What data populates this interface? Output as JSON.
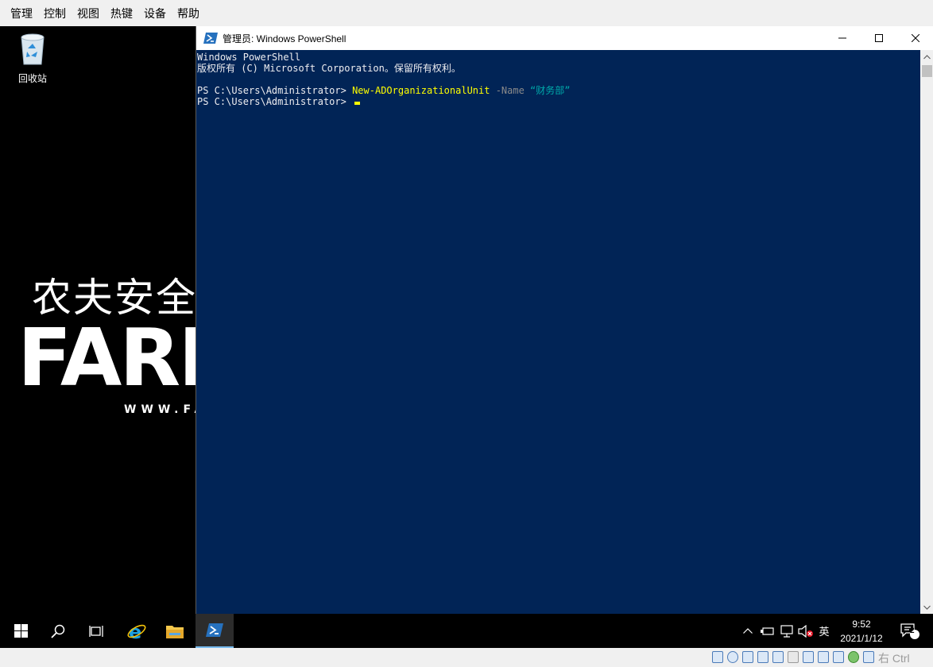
{
  "host_menu": {
    "items": [
      "管理",
      "控制",
      "视图",
      "热键",
      "设备",
      "帮助"
    ]
  },
  "desktop": {
    "recycle_bin_label": "回收站",
    "wallpaper": {
      "cn_text": "农夫安全",
      "logo_text": "FARM",
      "url_text": "WWW.FA"
    }
  },
  "powershell": {
    "title": "管理员: Windows PowerShell",
    "lines": {
      "line1": "Windows PowerShell",
      "line2": "版权所有 (C) Microsoft Corporation。保留所有权利。",
      "prompt1": "PS C:\\Users\\Administrator> ",
      "cmd": "New-ADOrganizationalUnit",
      "param": " -Name ",
      "arg": "“财务部”",
      "prompt2": "PS C:\\Users\\Administrator> "
    },
    "colors": {
      "background": "#012456",
      "command": "#ffff00",
      "parameter": "#8a8a8a",
      "string": "#00aaaa"
    }
  },
  "taskbar": {
    "icons": [
      "windows-start-icon",
      "search-icon",
      "task-view-icon",
      "internet-explorer-icon",
      "file-explorer-icon",
      "powershell-icon"
    ],
    "tray": {
      "ime": "英",
      "time": "9:52",
      "date": "2021/1/12",
      "notification_count": "2"
    }
  },
  "host_status": {
    "host_key": "右 Ctrl"
  }
}
